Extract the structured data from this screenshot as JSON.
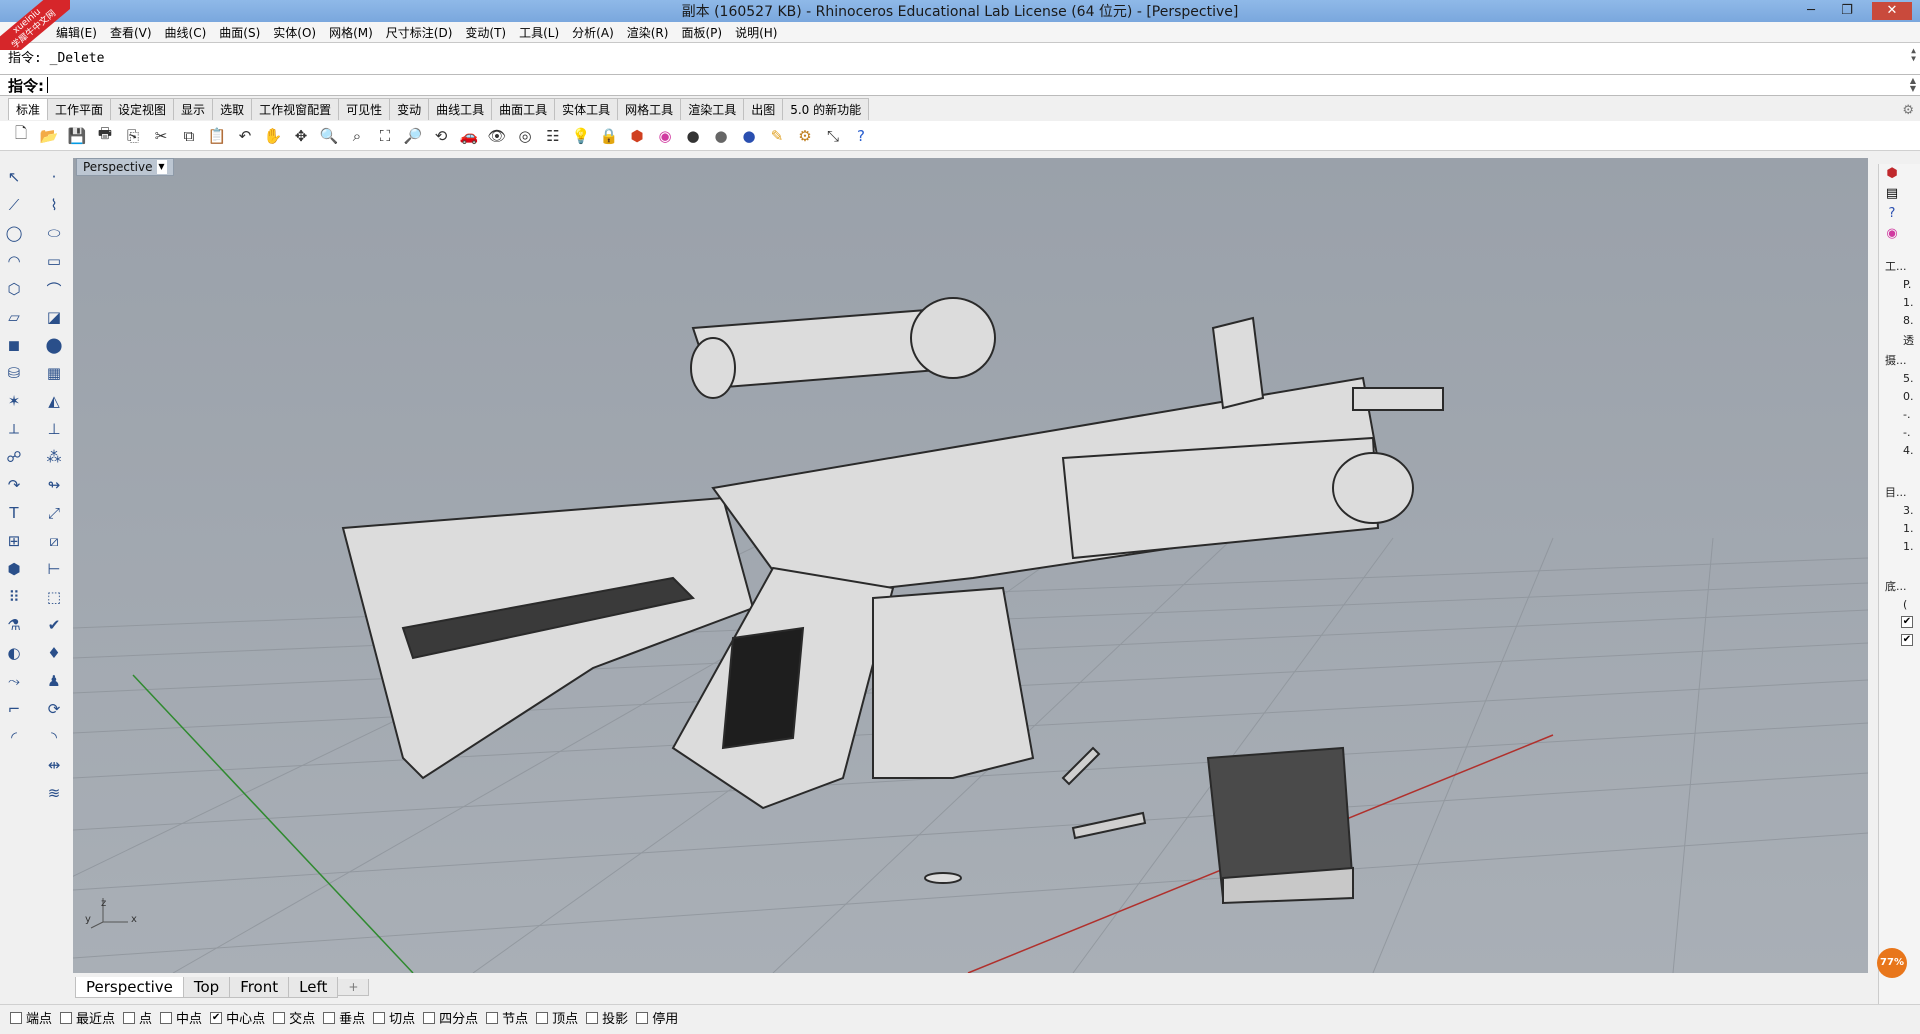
{
  "window": {
    "title": "副本 (160527 KB) - Rhinoceros Educational Lab License (64 位元) - [Perspective]",
    "min": "─",
    "restore": "❐",
    "close": "✕"
  },
  "watermark": {
    "line1": "xueiniu",
    "line2": "学犀牛中文网"
  },
  "menu": [
    "编辑(E)",
    "查看(V)",
    "曲线(C)",
    "曲面(S)",
    "实体(O)",
    "网格(M)",
    "尺寸标注(D)",
    "变动(T)",
    "工具(L)",
    "分析(A)",
    "渲染(R)",
    "面板(P)",
    "说明(H)"
  ],
  "command": {
    "history": "指令: _Delete",
    "prompt": "指令:"
  },
  "toolbar_tabs": [
    "标准",
    "工作平面",
    "设定视图",
    "显示",
    "选取",
    "工作视窗配置",
    "可见性",
    "变动",
    "曲线工具",
    "曲面工具",
    "实体工具",
    "网格工具",
    "渲染工具",
    "出图",
    "5.0 的新功能"
  ],
  "toolbar_icons": [
    "new-icon",
    "open-icon",
    "save-icon",
    "print-icon",
    "import-icon",
    "cut-icon",
    "copy-icon",
    "paste-icon",
    "undo-icon",
    "pan-hand-icon",
    "move-view-icon",
    "zoom-icon",
    "zoom-window-icon",
    "zoom-extents-icon",
    "zoom-selected-icon",
    "rotate-view-icon",
    "car-icon",
    "named-view-icon",
    "cplane-icon",
    "layer-icon",
    "light-icon",
    "lock-icon",
    "render-icon",
    "color-wheel-icon",
    "material-icon",
    "sphere-icon",
    "render-sphere-icon",
    "highlight-icon",
    "gear-icon",
    "transform-icon",
    "help-icon"
  ],
  "viewport": {
    "label": "Perspective",
    "axis_z": "z",
    "axis_y": "y",
    "axis_x": "x"
  },
  "view_tabs": [
    "Perspective",
    "Top",
    "Front",
    "Left",
    "+"
  ],
  "osnaps": [
    {
      "label": "端点",
      "checked": false
    },
    {
      "label": "最近点",
      "checked": false
    },
    {
      "label": "点",
      "checked": false
    },
    {
      "label": "中点",
      "checked": false
    },
    {
      "label": "中心点",
      "checked": true
    },
    {
      "label": "交点",
      "checked": false
    },
    {
      "label": "垂点",
      "checked": false
    },
    {
      "label": "切点",
      "checked": false
    },
    {
      "label": "四分点",
      "checked": false
    },
    {
      "label": "节点",
      "checked": false
    },
    {
      "label": "顶点",
      "checked": false
    },
    {
      "label": "投影",
      "checked": false
    },
    {
      "label": "停用",
      "checked": false
    }
  ],
  "right_panel": {
    "texts": [
      "工...",
      "P.",
      "1.",
      "8.",
      "透",
      "摄...",
      "5.",
      "0.",
      "-.",
      "-.",
      "4.",
      "目...",
      "3.",
      "1.",
      "1.",
      "底...",
      "("
    ],
    "zoom": "77%"
  },
  "colors": {
    "viewport_bg": "#9aa0a8",
    "grid": "#8c929a",
    "x_axis": "#b0302c",
    "y_axis": "#2f8a2f",
    "title_bar": "#8fb9e8"
  }
}
